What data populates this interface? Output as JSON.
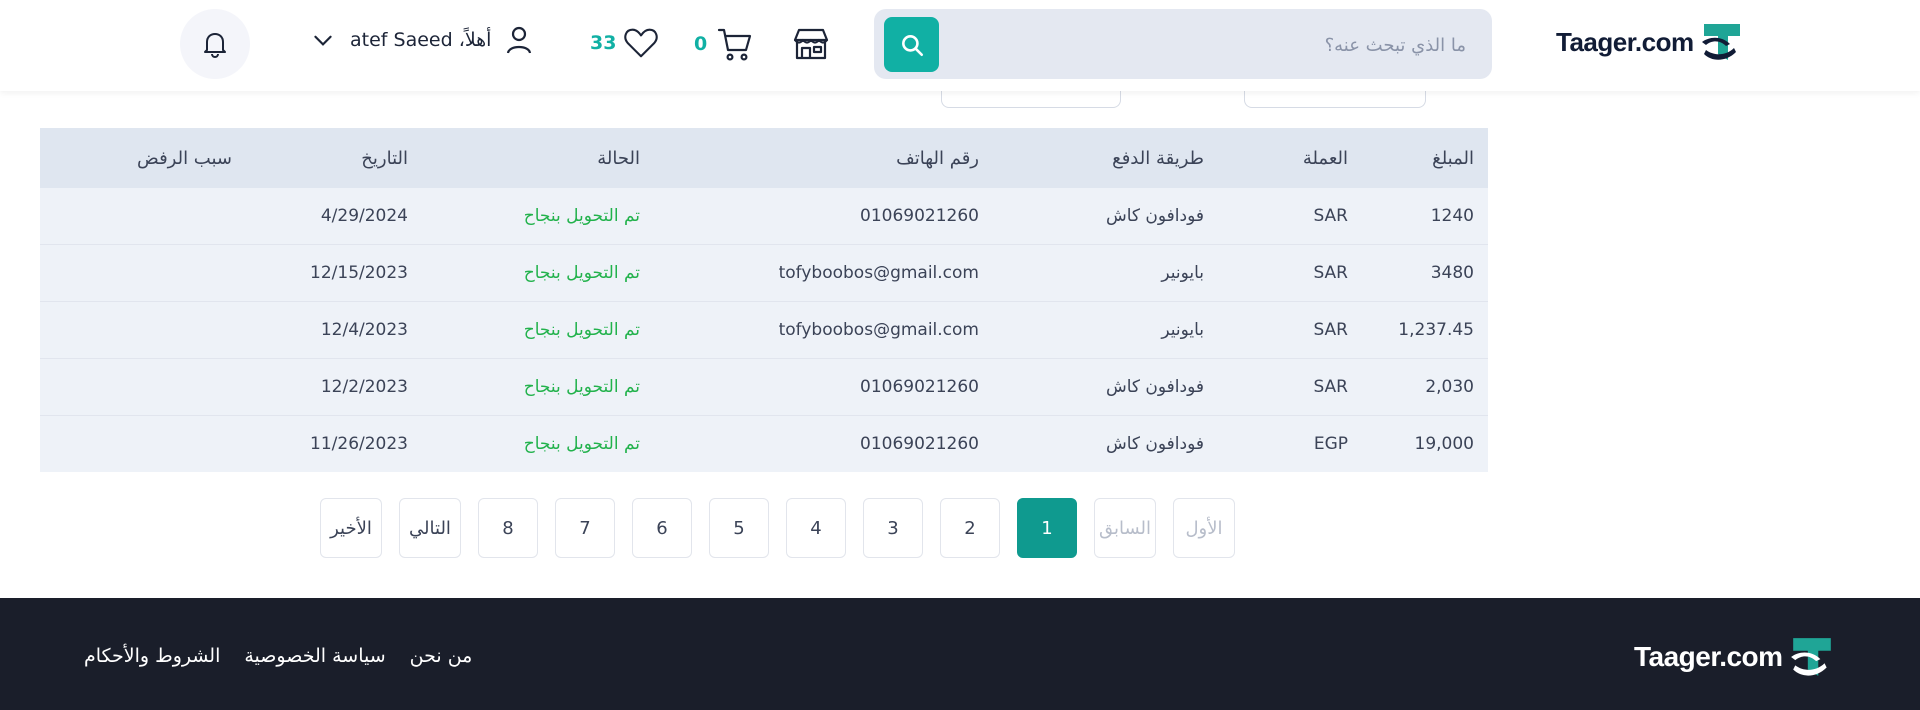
{
  "header": {
    "logo": "Taager.com",
    "search_placeholder": "ما الذي تبحث عنه؟",
    "cart_count": "0",
    "wishlist_count": "33",
    "greeting": "أهلاً، atef Saeed"
  },
  "colors": {
    "accent": "#11b0a4",
    "status_success": "#22b24c",
    "footer_bg": "#1a1e2a",
    "table_header_bg": "#dfe6f0"
  },
  "table": {
    "headers": {
      "amount": "المبلغ",
      "currency": "العملة",
      "method": "طريقة الدفع",
      "phone": "رقم الهاتف",
      "status": "الحالة",
      "date": "التاريخ",
      "reason": "سبب الرفض"
    },
    "rows": [
      {
        "amount": "1240",
        "currency": "SAR",
        "method": "فودافون كاش",
        "phone": "01069021260",
        "status": "تم التحويل بنجاح",
        "date": "4/29/2024",
        "reason": ""
      },
      {
        "amount": "3480",
        "currency": "SAR",
        "method": "بايونير",
        "phone": "tofyboobos@gmail.com",
        "status": "تم التحويل بنجاح",
        "date": "12/15/2023",
        "reason": ""
      },
      {
        "amount": "1,237.45",
        "currency": "SAR",
        "method": "بايونير",
        "phone": "tofyboobos@gmail.com",
        "status": "تم التحويل بنجاح",
        "date": "12/4/2023",
        "reason": ""
      },
      {
        "amount": "2,030",
        "currency": "SAR",
        "method": "فودافون كاش",
        "phone": "01069021260",
        "status": "تم التحويل بنجاح",
        "date": "12/2/2023",
        "reason": ""
      },
      {
        "amount": "19,000",
        "currency": "EGP",
        "method": "فودافون كاش",
        "phone": "01069021260",
        "status": "تم التحويل بنجاح",
        "date": "11/26/2023",
        "reason": ""
      }
    ]
  },
  "pagination": {
    "last": "الأخير",
    "next": "التالي",
    "pages": [
      "8",
      "7",
      "6",
      "5",
      "4",
      "3",
      "2",
      "1"
    ],
    "current": "1",
    "previous": "السابق",
    "first": "الأول"
  },
  "footer": {
    "logo": "Taager.com",
    "links": [
      "من نحن",
      "سياسة الخصوصية",
      "الشروط والأحكام"
    ]
  }
}
